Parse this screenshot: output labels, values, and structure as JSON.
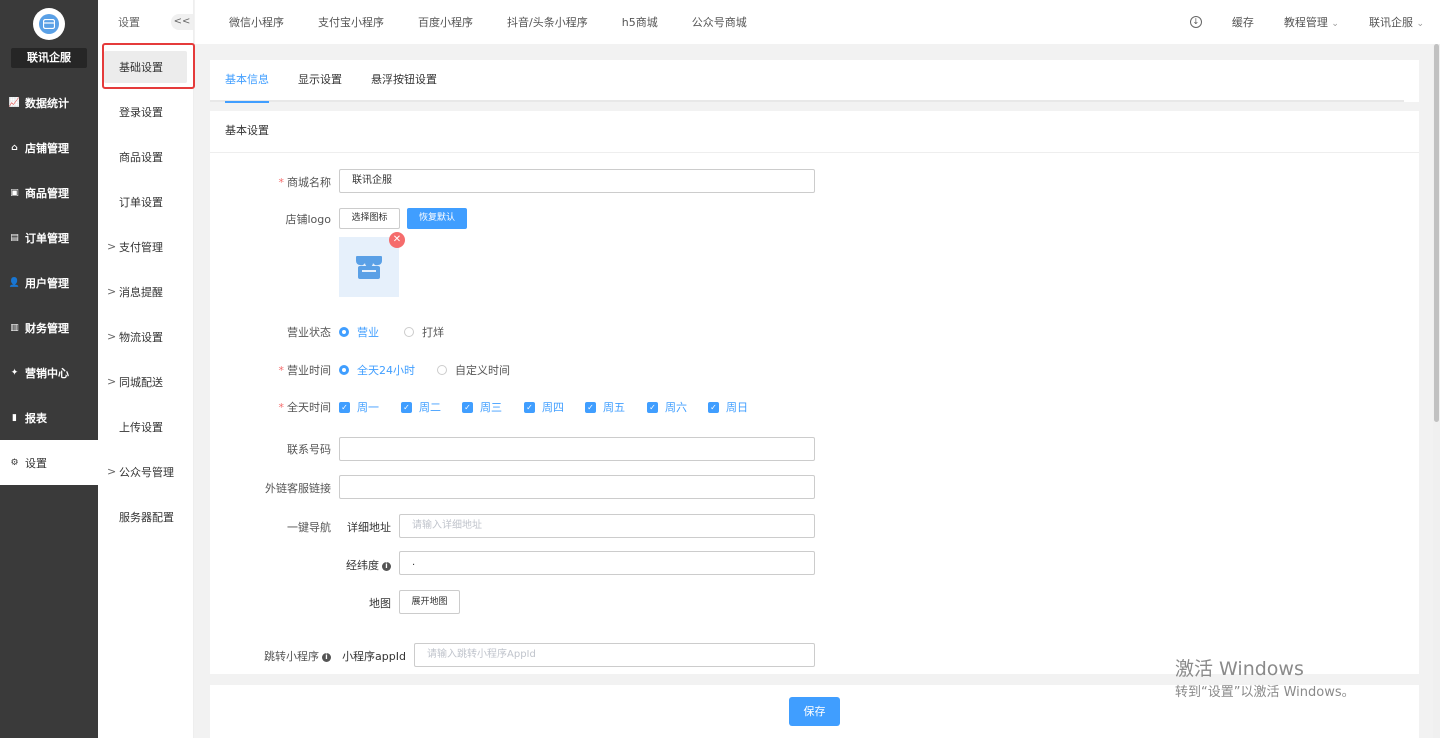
{
  "brand": "联讯企服",
  "nav": [
    {
      "label": "数据统计",
      "icon": "chart-line-icon"
    },
    {
      "label": "店铺管理",
      "icon": "shop-icon"
    },
    {
      "label": "商品管理",
      "icon": "goods-icon"
    },
    {
      "label": "订单管理",
      "icon": "order-icon"
    },
    {
      "label": "用户管理",
      "icon": "user-icon"
    },
    {
      "label": "财务管理",
      "icon": "finance-icon"
    },
    {
      "label": "营销中心",
      "icon": "marketing-icon"
    },
    {
      "label": "报表",
      "icon": "report-icon"
    },
    {
      "label": "设置",
      "icon": "gear-icon"
    }
  ],
  "submenu": {
    "title": "设置",
    "collapse": "<<",
    "items": [
      {
        "label": "基础设置",
        "chev": ""
      },
      {
        "label": "登录设置",
        "chev": ""
      },
      {
        "label": "商品设置",
        "chev": ""
      },
      {
        "label": "订单设置",
        "chev": ""
      },
      {
        "label": "支付管理",
        "chev": ">"
      },
      {
        "label": "消息提醒",
        "chev": ">"
      },
      {
        "label": "物流设置",
        "chev": ">"
      },
      {
        "label": "同城配送",
        "chev": ">"
      },
      {
        "label": "上传设置",
        "chev": ""
      },
      {
        "label": "公众号管理",
        "chev": ">"
      },
      {
        "label": "服务器配置",
        "chev": ""
      }
    ]
  },
  "topbar": {
    "tabs": [
      "微信小程序",
      "支付宝小程序",
      "百度小程序",
      "抖音/头条小程序",
      "h5商城",
      "公众号商城"
    ],
    "cache": "缓存",
    "tutorial": "教程管理",
    "user": "联讯企服"
  },
  "tabs": [
    "基本信息",
    "显示设置",
    "悬浮按钮设置"
  ],
  "card_title": "基本设置",
  "form": {
    "store_name_label": "商城名称",
    "store_name_value": "联讯企服",
    "logo_label": "店铺logo",
    "choose_icon": "选择图标",
    "restore_default": "恢复默认",
    "status_label": "营业状态",
    "status_open": "营业",
    "status_closed": "打烊",
    "hours_label": "营业时间",
    "hours_all": "全天24小时",
    "hours_custom": "自定义时间",
    "days_label": "全天时间",
    "days": [
      "周一",
      "周二",
      "周三",
      "周四",
      "周五",
      "周六",
      "周日"
    ],
    "phone_label": "联系号码",
    "cs_label": "外链客服链接",
    "nav_label": "一键导航",
    "address_label": "详细地址",
    "address_placeholder": "请输入详细地址",
    "latlng_label": "经纬度",
    "latlng_value": ".",
    "map_label": "地图",
    "map_button": "展开地图",
    "mini_label": "跳转小程序",
    "appid_label": "小程序appId",
    "appid_placeholder": "请输入跳转小程序AppId"
  },
  "save": "保存",
  "watermark": {
    "line1": "激活 Windows",
    "line2": "转到“设置”以激活 Windows。"
  }
}
